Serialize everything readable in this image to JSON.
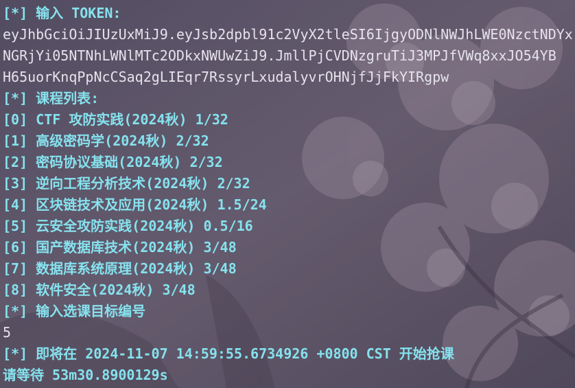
{
  "terminal": {
    "prompt_tag": "[*]",
    "token_prompt": "输入 TOKEN:",
    "token_lines": [
      "eyJhbGciOiJIUzUxMiJ9.eyJsb2dpbl91c2VyX2tleSI6IjgyODNlNWJhLWE0NzctNDYx",
      "NGRjYi05NTNhLWNlMTc2ODkxNWUwZiJ9.JmllPjCVDNzgruTiJ3MPJfVWq8xxJO54YB",
      "H65uorKnqPpNcCSaq2gLIEqr7RssyrLxudalyvrOHNjfJjFkYIRgpw"
    ],
    "course_list_title": "课程列表:",
    "courses": [
      {
        "index": "[0]",
        "text": "CTF 攻防实践(2024秋) 1/32"
      },
      {
        "index": "[1]",
        "text": "高级密码学(2024秋) 2/32"
      },
      {
        "index": "[2]",
        "text": "密码协议基础(2024秋) 2/32"
      },
      {
        "index": "[3]",
        "text": "逆向工程分析技术(2024秋) 2/32"
      },
      {
        "index": "[4]",
        "text": "区块链技术及应用(2024秋) 1.5/24"
      },
      {
        "index": "[5]",
        "text": "云安全攻防实践(2024秋) 0.5/16"
      },
      {
        "index": "[6]",
        "text": "国产数据库技术(2024秋) 3/48"
      },
      {
        "index": "[7]",
        "text": "数据库系统原理(2024秋) 3/48"
      },
      {
        "index": "[8]",
        "text": "软件安全(2024秋) 3/48"
      }
    ],
    "select_prompt": "输入选课目标编号",
    "user_input": "5",
    "schedule_line": "即将在 2024-11-07 14:59:55.6734926 +0800 CST 开始抢课",
    "wait_line": "请等待 53m30.8900129s"
  },
  "colors": {
    "accent": "#86e2ee",
    "plain_text": "#e6e3ec",
    "background": "#6c6378"
  }
}
